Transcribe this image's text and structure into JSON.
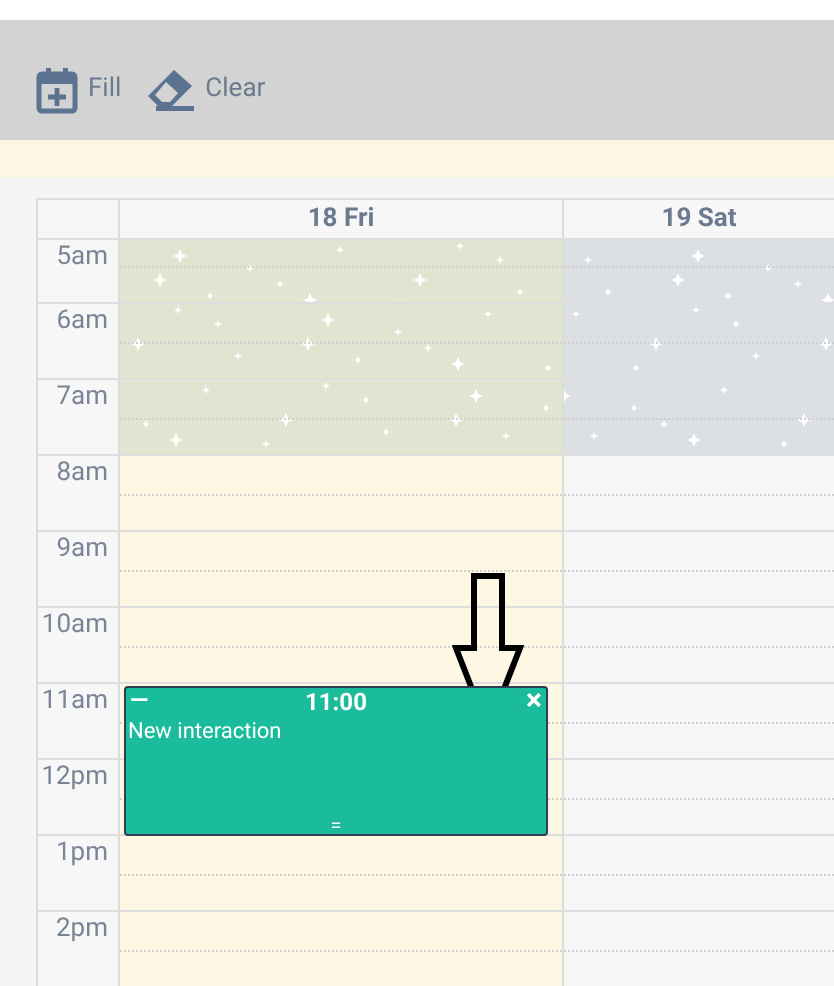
{
  "toolbar": [
    {
      "label": "Fill",
      "kind": "fill"
    },
    {
      "label": "Clear",
      "kind": "clear"
    }
  ],
  "days": [
    {
      "label": "18 Fri",
      "highlighted": true
    },
    {
      "label": "19 Sat",
      "highlighted": false
    }
  ],
  "hours": [
    {
      "label": "5am",
      "night": true,
      "cells": [
        {},
        {}
      ]
    },
    {
      "label": "6am",
      "night": true,
      "cells": [
        {},
        {}
      ]
    },
    {
      "label": "7am",
      "night": true,
      "cells": [
        {},
        {}
      ]
    },
    {
      "label": "8am",
      "night": false,
      "cells": [
        {},
        {}
      ]
    },
    {
      "label": "9am",
      "night": false,
      "cells": [
        {},
        {}
      ]
    },
    {
      "label": "10am",
      "night": false,
      "cells": [
        {},
        {}
      ]
    },
    {
      "label": "11am",
      "night": false,
      "cells": [
        {
          "event": {
            "time": "11:00",
            "title": "New interaction",
            "minimize": "—",
            "close": "×",
            "handle": "="
          }
        },
        {}
      ]
    },
    {
      "label": "12pm",
      "night": false,
      "cells": [
        {},
        {}
      ]
    },
    {
      "label": "1pm",
      "night": false,
      "cells": [
        {},
        {}
      ]
    },
    {
      "label": "2pm",
      "night": false,
      "cells": [
        {},
        {}
      ]
    }
  ]
}
